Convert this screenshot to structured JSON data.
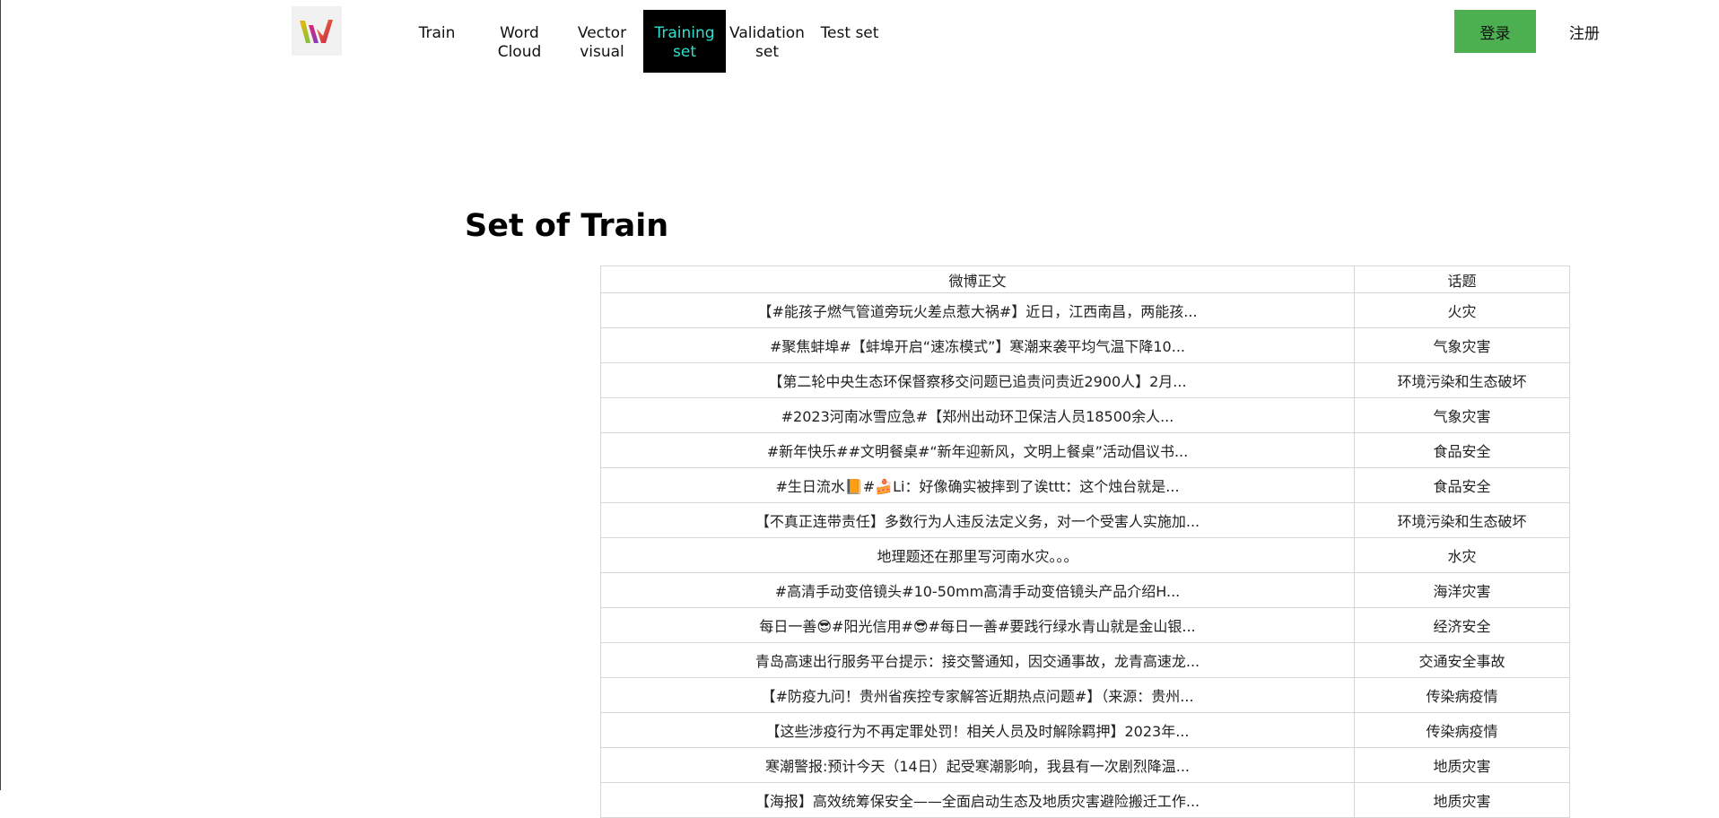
{
  "logo": {
    "icon": "colorful-w-logo-icon"
  },
  "nav": {
    "items": [
      {
        "label": "Train",
        "active": false
      },
      {
        "label": "Word\nCloud",
        "active": false
      },
      {
        "label": "Vector\nvisual",
        "active": false
      },
      {
        "label": "Training\nset",
        "active": true
      },
      {
        "label": "Validation\nset",
        "active": false
      },
      {
        "label": "Test set",
        "active": false
      }
    ],
    "active_color": "#2fe0cf"
  },
  "auth": {
    "login_label": "登录",
    "register_label": "注册",
    "login_color": "#4caf50"
  },
  "main": {
    "title": "Set of Train",
    "table": {
      "headers": [
        "微博正文",
        "话题"
      ],
      "rows": [
        [
          "【#能孩子燃气管道旁玩火差点惹大祸#】近日，江西南昌，两能孩...",
          "火灾"
        ],
        [
          "#聚焦蚌埠#【蚌埠开启“速冻模式”】寒潮来袭平均气温下降10...",
          "气象灾害"
        ],
        [
          "【第二轮中央生态环保督察移交问题已追责问责近2900人】2月...",
          "环境污染和生态破坏"
        ],
        [
          "#2023河南冰雪应急#【郑州出动环卫保洁人员18500余人...",
          "气象灾害"
        ],
        [
          "#新年快乐##文明餐桌#“新年迎新风，文明上餐桌”活动倡议书...",
          "食品安全"
        ],
        [
          "#生日流水📙#🍰Li：好像确实被摔到了诶ttt：这个烛台就是...",
          "食品安全"
        ],
        [
          "【不真正连带责任】多数行为人违反法定义务，对一个受害人实施加...",
          "环境污染和生态破坏"
        ],
        [
          "地理题还在那里写河南水灾。。。",
          "水灾"
        ],
        [
          "#高清手动变倍镜头#10-50mm高清手动变倍镜头产品介绍H...",
          "海洋灾害"
        ],
        [
          "每日一善😎#阳光信用#😎#每日一善#要践行绿水青山就是金山银...",
          "经济安全"
        ],
        [
          "青岛高速出行服务平台提示：接交警通知，因交通事故，龙青高速龙...",
          "交通安全事故"
        ],
        [
          "【#防疫九问！贵州省疾控专家解答近期热点问题#】（来源：贵州...",
          "传染病疫情"
        ],
        [
          "【这些涉疫行为不再定罪处罚！相关人员及时解除羁押】2023年...",
          "传染病疫情"
        ],
        [
          "寒潮警报:预计今天（14日）起受寒潮影响，我县有一次剧烈降温...",
          "地质灾害"
        ],
        [
          "【海报】高效统筹保安全——全面启动生态及地质灾害避险搬迁工作...",
          "地质灾害"
        ]
      ]
    }
  }
}
